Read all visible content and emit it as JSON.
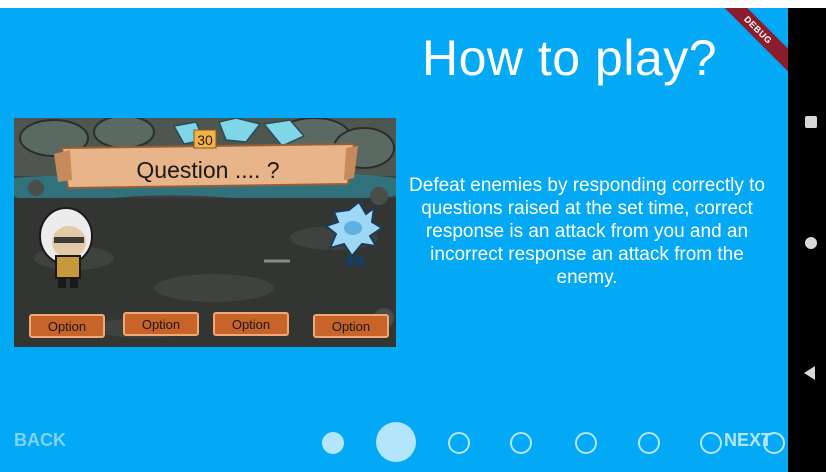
{
  "page": {
    "title": "How to play?",
    "debug_banner": "DEBUG",
    "description": "Defeat enemies by responding correctly to questions raised at the set time, correct response is an attack from you and an incorrect response an attack from the enemy."
  },
  "game_preview": {
    "timer": "30",
    "question": "Question .... ?",
    "options": [
      "Option",
      "Option",
      "Option",
      "Option"
    ]
  },
  "footer": {
    "back_label": "BACK",
    "next_label": "NEXT",
    "page_indicator": {
      "total": 8,
      "current": 2
    }
  },
  "colors": {
    "background": "#03a9f4",
    "accent_light": "#b3e5fc",
    "option_button": "#c8642a"
  }
}
